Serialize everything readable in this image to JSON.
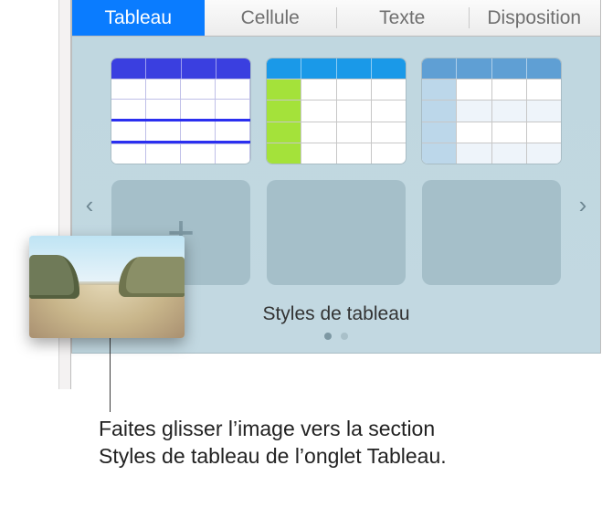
{
  "tabs": {
    "items": [
      {
        "label": "Tableau",
        "active": true
      },
      {
        "label": "Cellule",
        "active": false
      },
      {
        "label": "Texte",
        "active": false
      },
      {
        "label": "Disposition",
        "active": false
      }
    ]
  },
  "styles": {
    "section_title": "Styles de tableau",
    "thumbnails": [
      {
        "kind": "style",
        "variant": "s1"
      },
      {
        "kind": "style",
        "variant": "s2"
      },
      {
        "kind": "style",
        "variant": "s3"
      },
      {
        "kind": "add"
      },
      {
        "kind": "empty"
      },
      {
        "kind": "empty"
      }
    ],
    "add_glyph": "+",
    "pager": {
      "count": 2,
      "active_index": 0
    }
  },
  "nav": {
    "prev_glyph": "‹",
    "next_glyph": "›"
  },
  "callout": {
    "text": "Faites glisser l’image vers la section Styles de tableau de l’onglet Tableau."
  },
  "dragged_image": {
    "description": "beach-photo-thumbnail"
  }
}
